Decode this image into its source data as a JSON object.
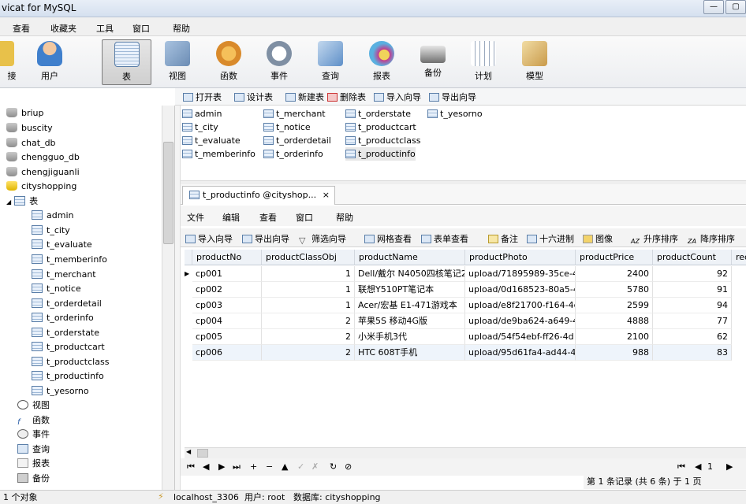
{
  "window": {
    "title": "vicat for MySQL",
    "btn_min": "—",
    "btn_max": "▢"
  },
  "menu": [
    "查看",
    "收藏夹",
    "工具",
    "窗口",
    "帮助"
  ],
  "ribbon": [
    {
      "label": "接",
      "icon": "connection-icon",
      "color": "#e8c14a"
    },
    {
      "label": "用户",
      "icon": "user-icon",
      "color": "#3f7fcc"
    },
    {
      "label": "表",
      "icon": "table-icon",
      "color": "#4d82c4"
    },
    {
      "label": "视图",
      "icon": "view-icon",
      "color": "#6b8cb4"
    },
    {
      "label": "函数",
      "icon": "function-icon",
      "color": "#d98a2b"
    },
    {
      "label": "事件",
      "icon": "event-icon",
      "color": "#7f8fa3"
    },
    {
      "label": "查询",
      "icon": "query-icon",
      "color": "#5e8fc8"
    },
    {
      "label": "报表",
      "icon": "report-icon",
      "color": "#c43b8d"
    },
    {
      "label": "备份",
      "icon": "backup-icon",
      "color": "#6f6f6f"
    },
    {
      "label": "计划",
      "icon": "schedule-icon",
      "color": "#9aa9bd"
    },
    {
      "label": "模型",
      "icon": "model-icon",
      "color": "#c99a4a"
    }
  ],
  "objtoolbar": [
    "打开表",
    "设计表",
    "新建表",
    "删除表",
    "导入向导",
    "导出向导"
  ],
  "databases": [
    "briup",
    "buscity",
    "chat_db",
    "chengguo_db",
    "chengjiguanli",
    "cityshopping"
  ],
  "tree_tables_label": "表",
  "tables": [
    "admin",
    "t_city",
    "t_evaluate",
    "t_memberinfo",
    "t_merchant",
    "t_notice",
    "t_orderdetail",
    "t_orderinfo",
    "t_orderstate",
    "t_productcart",
    "t_productclass",
    "t_productinfo",
    "t_yesorno"
  ],
  "tree_others": [
    "视图",
    "函数",
    "事件",
    "查询",
    "报表",
    "备份"
  ],
  "objects": [
    "admin",
    "t_city",
    "t_evaluate",
    "t_memberinfo",
    "t_merchant",
    "t_notice",
    "t_orderdetail",
    "t_orderinfo",
    "t_orderstate",
    "t_productcart",
    "t_productclass",
    "t_productinfo",
    "t_yesorno"
  ],
  "tab": {
    "label": "t_productinfo @cityshop...",
    "close": "×"
  },
  "innermenu": [
    "文件",
    "编辑",
    "查看",
    "窗口",
    "帮助"
  ],
  "gridtoolbar": [
    "导入向导",
    "导出向导",
    "筛选向导",
    "网格查看",
    "表单查看",
    "备注",
    "十六进制",
    "图像",
    "升序排序",
    "降序排序"
  ],
  "grid": {
    "columns": [
      "productNo",
      "productClassObj",
      "productName",
      "productPhoto",
      "productPrice",
      "productCount",
      "rec"
    ],
    "rows": [
      [
        "cp001",
        "1",
        "Dell/戴尔 N4050四核笔记2",
        "upload/71895989-35ce-4",
        "2400",
        "92"
      ],
      [
        "cp002",
        "1",
        "联想Y510PT笔记本",
        "upload/0d168523-80a5-4",
        "5780",
        "91"
      ],
      [
        "cp003",
        "1",
        "Acer/宏基 E1-471游戏本",
        "upload/e8f21700-f164-4c",
        "2599",
        "94"
      ],
      [
        "cp004",
        "2",
        "苹果5S 移动4G版",
        "upload/de9ba624-a649-4",
        "4888",
        "77"
      ],
      [
        "cp005",
        "2",
        "小米手机3代",
        "upload/54f54ebf-ff26-4d",
        "2100",
        "62"
      ],
      [
        "cp006",
        "2",
        "HTC 608T手机",
        "upload/95d61fa4-ad44-4",
        "988",
        "83"
      ]
    ]
  },
  "navigator": [
    "⏮",
    "◀",
    "▶",
    "⏭",
    "+",
    "−",
    "▲",
    "✓",
    "✗",
    "↻",
    "⊘"
  ],
  "pager": {
    "first": "⏮",
    "prev": "◀",
    "page": "1",
    "next": "▶"
  },
  "page_record": "第 1 条记录 (共 6 条) 于 1 页",
  "status": {
    "objects": "1 个对象",
    "connection": "localhost_3306",
    "user": "用户: root",
    "database": "数据库: cityshopping"
  }
}
